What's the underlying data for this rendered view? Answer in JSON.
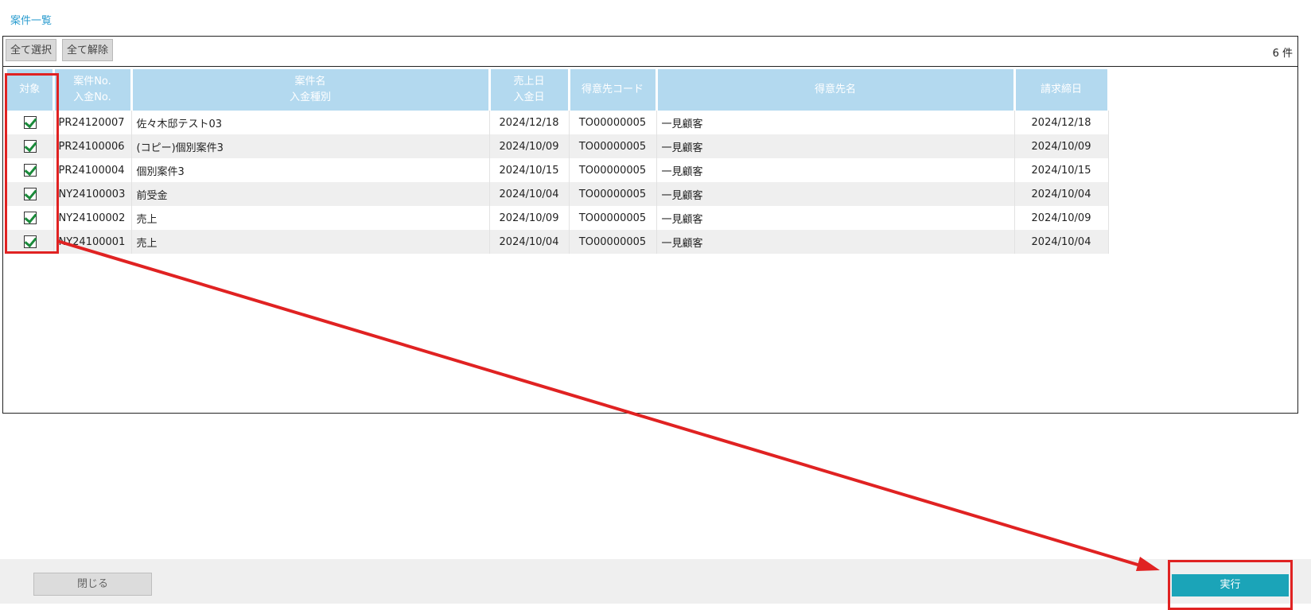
{
  "page": {
    "title": "案件一覧"
  },
  "toolbar": {
    "select_all_label": "全て選択",
    "deselect_all_label": "全て解除",
    "count_label": "6 件"
  },
  "table": {
    "headers": {
      "target": "対象",
      "case_no_line1": "案件No.",
      "case_no_line2": "入金No.",
      "case_name_line1": "案件名",
      "case_name_line2": "入金種別",
      "sales_date_line1": "売上日",
      "sales_date_line2": "入金日",
      "customer_code": "得意先コード",
      "customer_name": "得意先名",
      "closing_date": "請求締日"
    },
    "rows": [
      {
        "checked": true,
        "case_no": "PR24120007",
        "case_name": "佐々木邸テスト03",
        "sales_date": "2024/12/18",
        "customer_code": "TO00000005",
        "customer_name": "一見顧客",
        "closing_date": "2024/12/18"
      },
      {
        "checked": true,
        "case_no": "PR24100006",
        "case_name": "(コピー)個別案件3",
        "sales_date": "2024/10/09",
        "customer_code": "TO00000005",
        "customer_name": "一見顧客",
        "closing_date": "2024/10/09"
      },
      {
        "checked": true,
        "case_no": "PR24100004",
        "case_name": "個別案件3",
        "sales_date": "2024/10/15",
        "customer_code": "TO00000005",
        "customer_name": "一見顧客",
        "closing_date": "2024/10/15"
      },
      {
        "checked": true,
        "case_no": "NY24100003",
        "case_name": "前受金",
        "sales_date": "2024/10/04",
        "customer_code": "TO00000005",
        "customer_name": "一見顧客",
        "closing_date": "2024/10/04"
      },
      {
        "checked": true,
        "case_no": "NY24100002",
        "case_name": "売上",
        "sales_date": "2024/10/09",
        "customer_code": "TO00000005",
        "customer_name": "一見顧客",
        "closing_date": "2024/10/09"
      },
      {
        "checked": true,
        "case_no": "NY24100001",
        "case_name": "売上",
        "sales_date": "2024/10/04",
        "customer_code": "TO00000005",
        "customer_name": "一見顧客",
        "closing_date": "2024/10/04"
      }
    ]
  },
  "footer": {
    "close_label": "閉じる",
    "run_label": "実行"
  },
  "colors": {
    "header_bg": "#b3d9ef",
    "run_button": "#1ba4b8",
    "annotation": "#e02222",
    "check": "#1a8a3a"
  }
}
